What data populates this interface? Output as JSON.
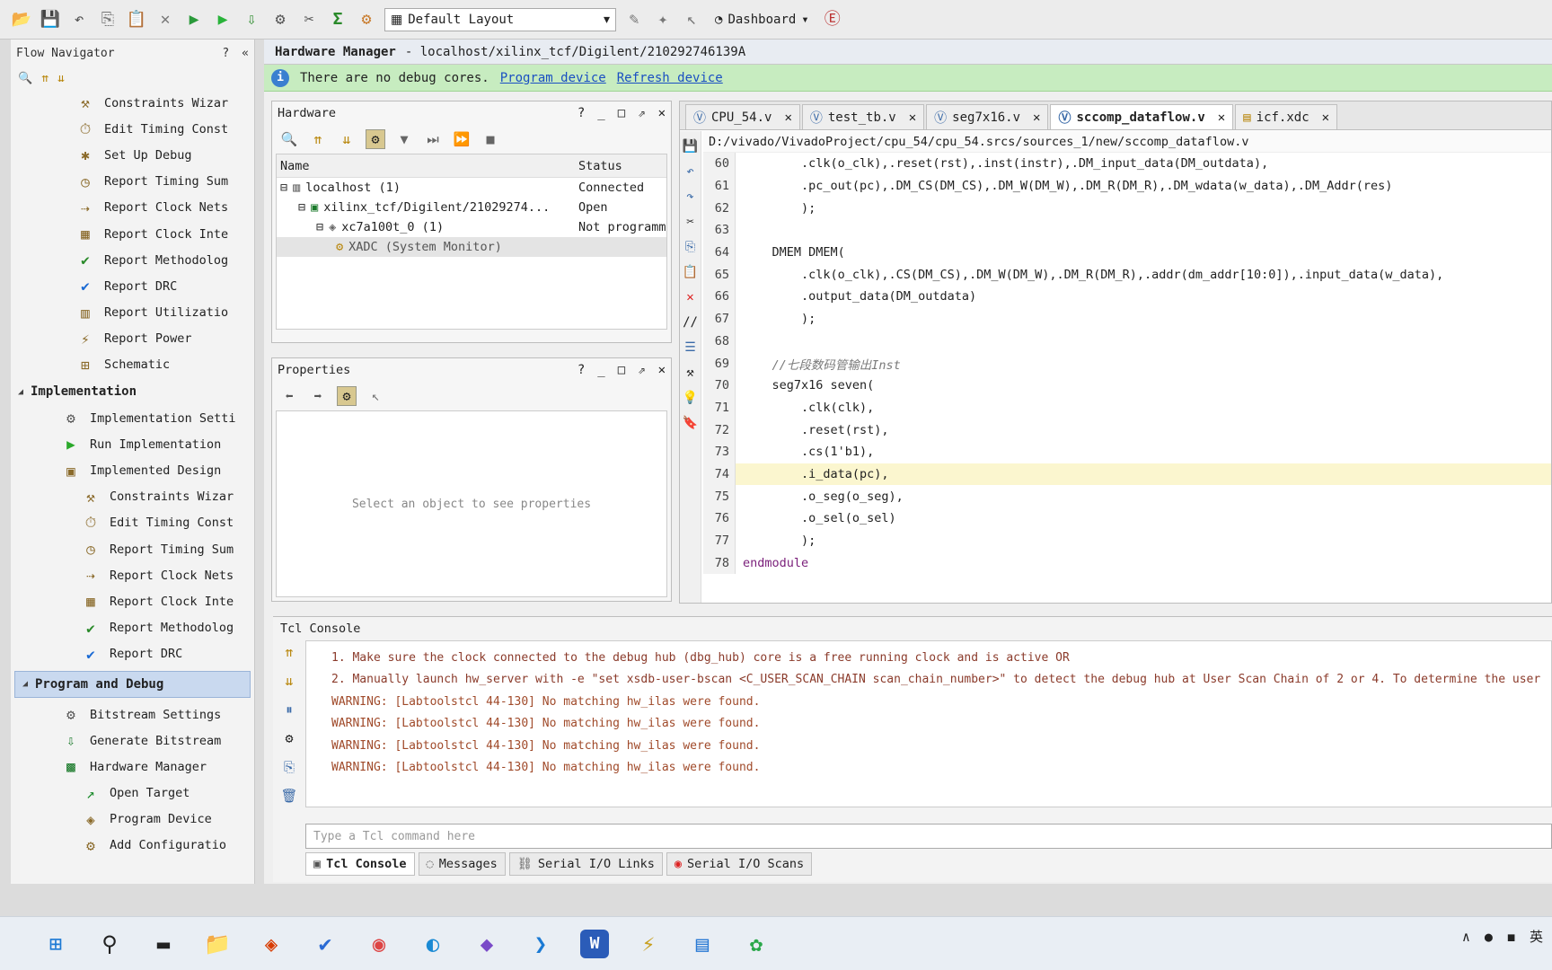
{
  "toolbar": {
    "layout_label": "Default Layout",
    "dashboard_label": "Dashboard"
  },
  "flow_nav": {
    "title": "Flow Navigator",
    "help": "?",
    "collapse": "«",
    "synth_items": [
      {
        "label": "Constraints Wizar",
        "icon": "wizard-icon"
      },
      {
        "label": "Edit Timing Const",
        "icon": "clock-icon"
      },
      {
        "label": "Set Up Debug",
        "icon": "bug-icon"
      },
      {
        "label": "Report Timing Sum",
        "icon": "timer-icon"
      },
      {
        "label": "Report Clock Nets",
        "icon": "clock-nets-icon"
      },
      {
        "label": "Report Clock Inte",
        "icon": "clock-interaction-icon"
      },
      {
        "label": "Report Methodolog",
        "icon": "methodology-icon"
      },
      {
        "label": "Report DRC",
        "icon": "check-icon"
      },
      {
        "label": "Report Utilizatio",
        "icon": "utilization-icon"
      },
      {
        "label": "Report Power",
        "icon": "power-icon"
      },
      {
        "label": "Schematic",
        "icon": "schematic-icon"
      }
    ],
    "impl_section": "Implementation",
    "impl_items": [
      {
        "label": "Implementation Setti",
        "icon": "settings-icon",
        "indent": 1
      },
      {
        "label": "Run Implementation",
        "icon": "play-icon",
        "indent": 1
      },
      {
        "label": "Implemented Design",
        "icon": "design-icon",
        "indent": 1
      },
      {
        "label": "Constraints Wizar",
        "icon": "wizard-icon",
        "indent": 2
      },
      {
        "label": "Edit Timing Const",
        "icon": "clock-icon",
        "indent": 2
      },
      {
        "label": "Report Timing Sum",
        "icon": "timer-icon",
        "indent": 2
      },
      {
        "label": "Report Clock Nets",
        "icon": "clock-nets-icon",
        "indent": 2
      },
      {
        "label": "Report Clock Inte",
        "icon": "clock-interaction-icon",
        "indent": 2
      },
      {
        "label": "Report Methodolog",
        "icon": "methodology-icon",
        "indent": 2
      },
      {
        "label": "Report DRC",
        "icon": "check-icon",
        "indent": 2
      }
    ],
    "prog_section": "Program and Debug",
    "prog_items": [
      {
        "label": "Bitstream Settings",
        "icon": "settings-icon",
        "indent": 1
      },
      {
        "label": "Generate Bitstream",
        "icon": "bitstream-icon",
        "indent": 1
      },
      {
        "label": "Hardware Manager",
        "icon": "chip-icon",
        "indent": 1
      },
      {
        "label": "Open Target",
        "icon": "open-target-icon",
        "indent": 2
      },
      {
        "label": "Program Device",
        "icon": "program-icon",
        "indent": 2
      },
      {
        "label": "Add Configuratio",
        "icon": "config-icon",
        "indent": 2
      }
    ]
  },
  "hw_manager": {
    "title": "Hardware Manager",
    "path": "- localhost/xilinx_tcf/Digilent/210292746139A",
    "banner_text": "There are no debug cores.",
    "program_link": "Program device",
    "refresh_link": "Refresh device"
  },
  "hardware_panel": {
    "title": "Hardware",
    "col_name": "Name",
    "col_status": "Status",
    "rows": [
      {
        "name": "localhost (1)",
        "status": "Connected"
      },
      {
        "name": "xilinx_tcf/Digilent/21029274...",
        "status": "Open"
      },
      {
        "name": "xc7a100t_0 (1)",
        "status": "Not programme"
      },
      {
        "name": "XADC (System Monitor)",
        "status": ""
      }
    ]
  },
  "properties_panel": {
    "title": "Properties",
    "empty_text": "Select an object to see properties"
  },
  "editor": {
    "tabs": [
      {
        "label": "CPU_54.v"
      },
      {
        "label": "test_tb.v"
      },
      {
        "label": "seg7x16.v"
      },
      {
        "label": "sccomp_dataflow.v",
        "active": true
      },
      {
        "label": "icf.xdc"
      }
    ],
    "filepath": "D:/vivado/VivadoProject/cpu_54/cpu_54.srcs/sources_1/new/sccomp_dataflow.v",
    "lines": [
      {
        "n": "60",
        "text": "        .clk(o_clk),.reset(rst),.inst(instr),.DM_input_data(DM_outdata),"
      },
      {
        "n": "61",
        "text": "        .pc_out(pc),.DM_CS(DM_CS),.DM_W(DM_W),.DM_R(DM_R),.DM_wdata(w_data),.DM_Addr(res)"
      },
      {
        "n": "62",
        "text": "        );"
      },
      {
        "n": "63",
        "text": ""
      },
      {
        "n": "64",
        "text": "    DMEM DMEM("
      },
      {
        "n": "65",
        "text": "        .clk(o_clk),.CS(DM_CS),.DM_W(DM_W),.DM_R(DM_R),.addr(dm_addr[10:0]),.input_data(w_data),"
      },
      {
        "n": "66",
        "text": "        .output_data(DM_outdata)"
      },
      {
        "n": "67",
        "text": "        );"
      },
      {
        "n": "68",
        "text": ""
      },
      {
        "n": "69",
        "text": "    //七段数码管输出Inst",
        "comment": true
      },
      {
        "n": "70",
        "text": "    seg7x16 seven("
      },
      {
        "n": "71",
        "text": "        .clk(clk),"
      },
      {
        "n": "72",
        "text": "        .reset(rst),"
      },
      {
        "n": "73",
        "text": "        .cs(1'b1),"
      },
      {
        "n": "74",
        "text": "        .i_data(pc),",
        "highlight": true
      },
      {
        "n": "75",
        "text": "        .o_seg(o_seg),"
      },
      {
        "n": "76",
        "text": "        .o_sel(o_sel)"
      },
      {
        "n": "77",
        "text": "        );"
      },
      {
        "n": "78",
        "text": "endmodule",
        "keyword": true
      }
    ]
  },
  "tcl_console": {
    "title": "Tcl Console",
    "lines": [
      {
        "text": "1. Make sure the clock connected to the debug hub (dbg_hub) core is a free running clock and is active OR"
      },
      {
        "text": "2. Manually launch hw_server with -e \"set xsdb-user-bscan <C_USER_SCAN_CHAIN scan_chain_number>\" to detect the debug hub at User Scan Chain of 2 or 4. To determine the user"
      },
      {
        "text": "WARNING: [Labtoolstcl 44-130] No matching hw_ilas were found."
      },
      {
        "text": "WARNING: [Labtoolstcl 44-130] No matching hw_ilas were found."
      },
      {
        "text": "WARNING: [Labtoolstcl 44-130] No matching hw_ilas were found."
      },
      {
        "text": "WARNING: [Labtoolstcl 44-130] No matching hw_ilas were found."
      }
    ],
    "input_placeholder": "Type a Tcl command here",
    "tabs": [
      {
        "label": "Tcl Console",
        "icon": "console-icon",
        "active": true
      },
      {
        "label": "Messages",
        "icon": "messages-icon"
      },
      {
        "label": "Serial I/O Links",
        "icon": "link-icon"
      },
      {
        "label": "Serial I/O Scans",
        "icon": "scan-icon"
      }
    ]
  }
}
